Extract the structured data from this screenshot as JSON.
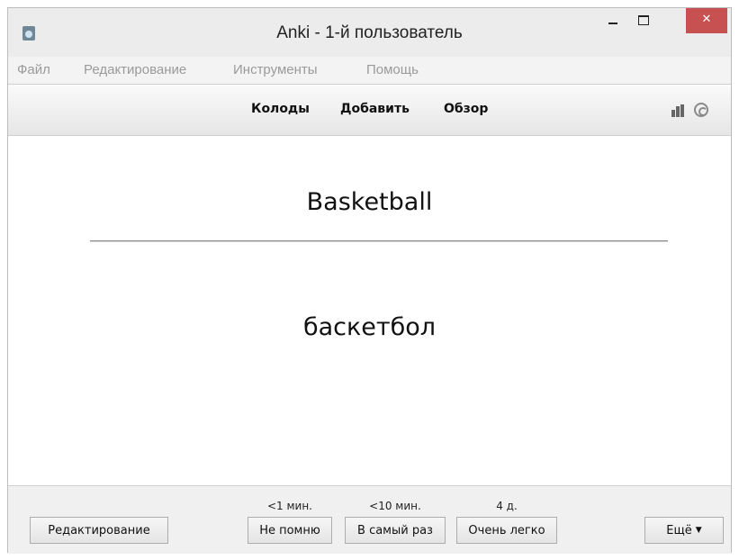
{
  "window": {
    "title": "Anki - 1-й пользователь",
    "close_glyph": "✕"
  },
  "menu": [
    "Файл",
    "Редактирование",
    "Инструменты",
    "Помощь"
  ],
  "toolbar": {
    "links": [
      "Колоды",
      "Добавить",
      "Обзор"
    ]
  },
  "card": {
    "question": "Basketball",
    "answer": "баскетбол"
  },
  "bottom": {
    "edit_label": "Редактирование",
    "intervals": [
      "<1 мин.",
      "<10 мин.",
      "4 д."
    ],
    "answers": [
      "Не помню",
      "В самый раз",
      "Очень легко"
    ],
    "more_label": "Ещё",
    "more_chevron": "▼"
  },
  "colors": {
    "close_button": "#c75050",
    "menu_text": "#9a9a9a"
  }
}
